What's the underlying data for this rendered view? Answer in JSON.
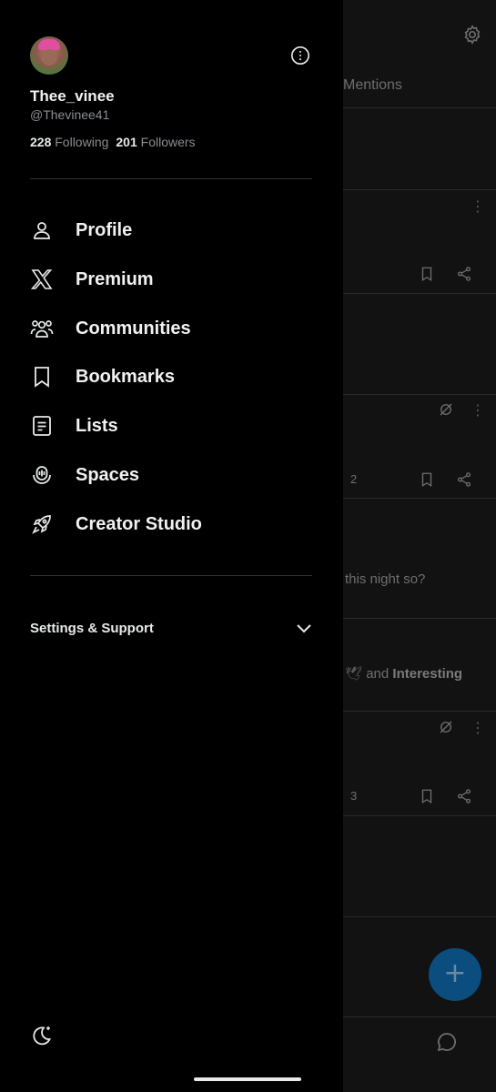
{
  "profile": {
    "display_name": "Thee_vinee",
    "handle": "@Thevinee41",
    "following_count": "228",
    "following_label": "Following",
    "followers_count": "201",
    "followers_label": "Followers"
  },
  "menu": {
    "items": [
      {
        "label": "Profile",
        "icon": "person-icon"
      },
      {
        "label": "Premium",
        "icon": "x-logo-icon"
      },
      {
        "label": "Communities",
        "icon": "communities-icon"
      },
      {
        "label": "Bookmarks",
        "icon": "bookmark-icon"
      },
      {
        "label": "Lists",
        "icon": "list-icon"
      },
      {
        "label": "Spaces",
        "icon": "spaces-icon"
      },
      {
        "label": "Creator Studio",
        "icon": "rocket-icon"
      }
    ]
  },
  "settings": {
    "label": "Settings & Support"
  },
  "background": {
    "tab_label": "Mentions",
    "snippet_1": "this night so?",
    "snippet_2_prefix": "and",
    "snippet_2_bold": "Interesting",
    "count_1": "2",
    "count_2": "3",
    "fab_symbol": "+"
  },
  "colors": {
    "background": "#000000",
    "text_primary": "#e7e9ea",
    "text_secondary": "#8a8d91",
    "divider": "#2f3336",
    "fab": "#1d9bf0"
  }
}
